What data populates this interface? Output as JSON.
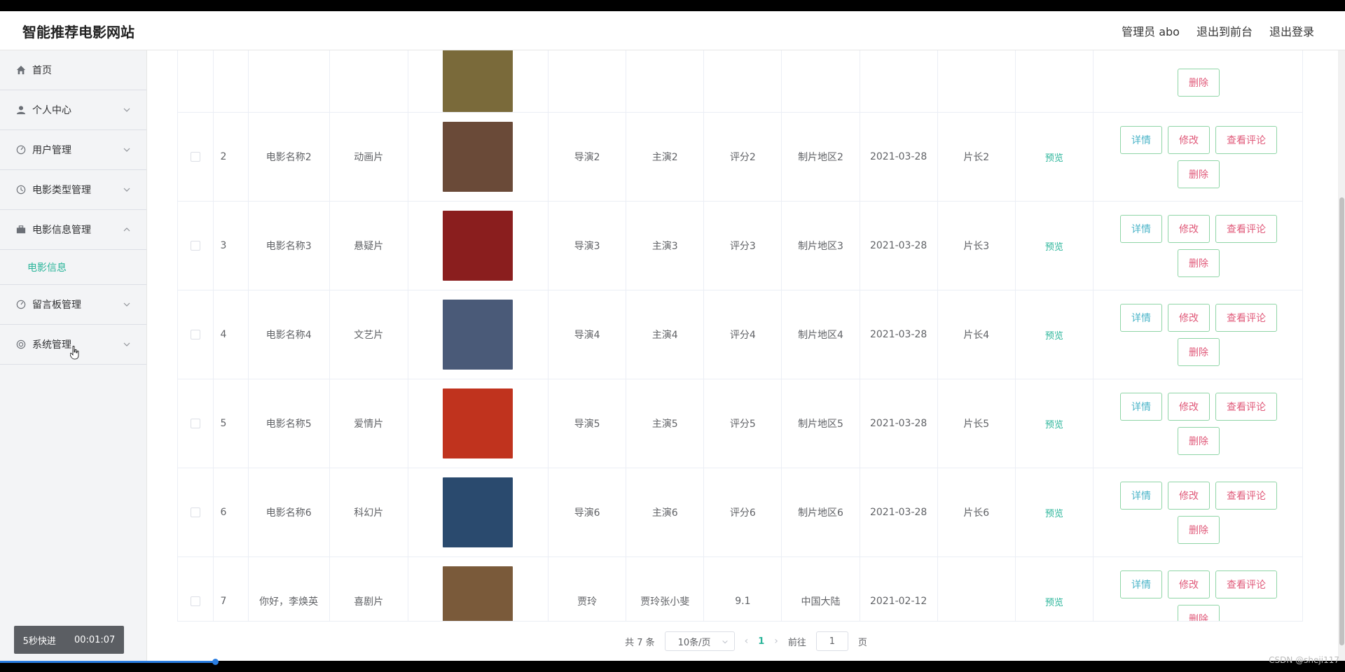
{
  "header": {
    "site_title": "智能推荐电影网站",
    "admin_label": "管理员 abo",
    "to_front": "退出到前台",
    "logout": "退出登录"
  },
  "sidebar": {
    "items": [
      {
        "label": "首页",
        "icon": "home-icon"
      },
      {
        "label": "个人中心",
        "icon": "user-icon"
      },
      {
        "label": "用户管理",
        "icon": "dashboard-icon"
      },
      {
        "label": "电影类型管理",
        "icon": "clock-icon"
      },
      {
        "label": "电影信息管理",
        "icon": "briefcase-icon"
      },
      {
        "label": "留言板管理",
        "icon": "dashboard-icon"
      },
      {
        "label": "系统管理",
        "icon": "lifebuoy-icon"
      }
    ],
    "submenu_label": "电影信息",
    "speed_label": "5秒快进",
    "timer": "00:01:07"
  },
  "table": {
    "delete_label": "删除",
    "detail_label": "详情",
    "edit_label": "修改",
    "comment_label": "查看评论",
    "preview_label": "预览",
    "rows": [
      {
        "index": "2",
        "name": "电影名称2",
        "type": "动画片",
        "director": "导演2",
        "actor": "主演2",
        "score": "评分2",
        "region": "制片地区2",
        "date": "2021-03-28",
        "length": "片长2",
        "poster_color": "#6a4a38"
      },
      {
        "index": "3",
        "name": "电影名称3",
        "type": "悬疑片",
        "director": "导演3",
        "actor": "主演3",
        "score": "评分3",
        "region": "制片地区3",
        "date": "2021-03-28",
        "length": "片长3",
        "poster_color": "#8a1e1e"
      },
      {
        "index": "4",
        "name": "电影名称4",
        "type": "文艺片",
        "director": "导演4",
        "actor": "主演4",
        "score": "评分4",
        "region": "制片地区4",
        "date": "2021-03-28",
        "length": "片长4",
        "poster_color": "#4a5a78"
      },
      {
        "index": "5",
        "name": "电影名称5",
        "type": "爱情片",
        "director": "导演5",
        "actor": "主演5",
        "score": "评分5",
        "region": "制片地区5",
        "date": "2021-03-28",
        "length": "片长5",
        "poster_color": "#c0331e"
      },
      {
        "index": "6",
        "name": "电影名称6",
        "type": "科幻片",
        "director": "导演6",
        "actor": "主演6",
        "score": "评分6",
        "region": "制片地区6",
        "date": "2021-03-28",
        "length": "片长6",
        "poster_color": "#2a4a6e"
      },
      {
        "index": "7",
        "name": "你好，李焕英",
        "type": "喜剧片",
        "director": "贾玲",
        "actor": "贾玲张小斐",
        "score": "9.1",
        "region": "中国大陆",
        "date": "2021-02-12",
        "length": "",
        "poster_color": "#7a5a3a"
      }
    ]
  },
  "pager": {
    "total": "共 7 条",
    "page_size": "10条/页",
    "current_page": "1",
    "goto_label": "前往",
    "goto_value": "1",
    "page_suffix": "页"
  },
  "watermark": "CSDN @sheji117",
  "colors": {
    "accent": "#2bb59a",
    "danger_text": "#e05a7a",
    "info_text": "#4bb4c8",
    "button_border": "#8fd5a6"
  },
  "video_progress": 0.16
}
